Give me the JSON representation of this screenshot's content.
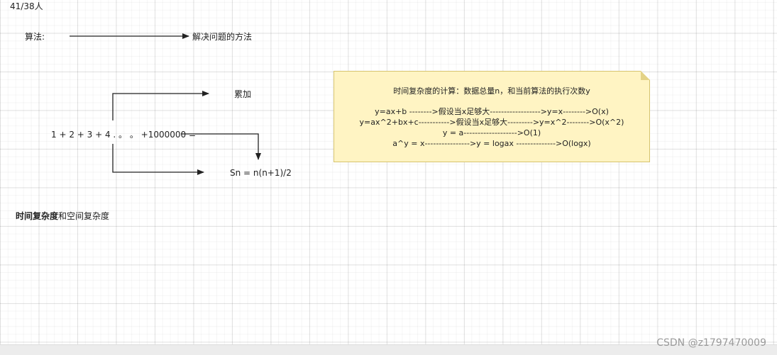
{
  "page_counter": "41/38人",
  "algorithm": {
    "term": "算法:",
    "definition": "解决问题的方法"
  },
  "summation": {
    "accumulate_label": "累加",
    "expression": "1 + 2 + 3 + 4 . 。 。 +1000000 =",
    "formula": "Sn = n(n+1)/2"
  },
  "section_heading": {
    "bold_part": "时间复杂度",
    "normal_part": "和空间复杂度"
  },
  "note": {
    "title": "时间复杂度的计算：数据总量n，和当前算法的执行次数y",
    "lines": [
      "y=ax+b  -------->假设当x足够大------------------>y=x-------->O(x)",
      "y=ax^2+bx+c----------->假设当x足够大--------->y=x^2-------->O(x^2)",
      "y = a------------------->O(1)",
      "a^y = x---------------->y = logax  -------------->O(logx)"
    ]
  },
  "watermark": "CSDN @z1797470009"
}
